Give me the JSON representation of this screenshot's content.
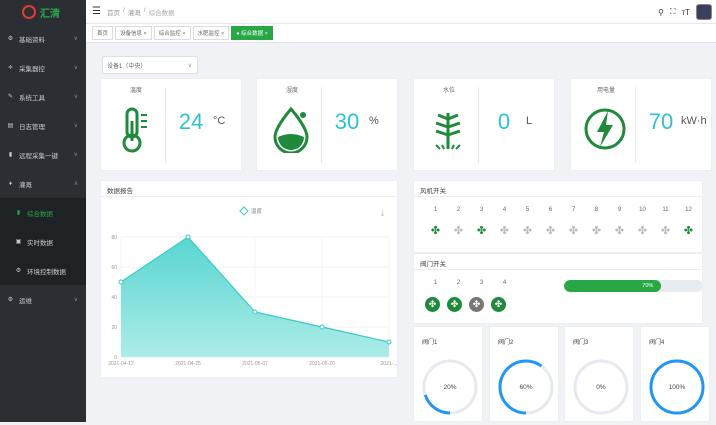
{
  "brand": {
    "name": "汇清"
  },
  "sidebar": {
    "items": [
      {
        "label": "基础资料",
        "icon": "gear-icon",
        "glyph": "⚙",
        "chev": "∨"
      },
      {
        "label": "采集器控",
        "icon": "sliders-icon",
        "glyph": "≑",
        "chev": "∨"
      },
      {
        "label": "系统工具",
        "icon": "wrench-icon",
        "glyph": "✎",
        "chev": "∨"
      },
      {
        "label": "日志管理",
        "icon": "doc-icon",
        "glyph": "▤",
        "chev": "∨"
      },
      {
        "label": "远程采集一键",
        "icon": "chart-icon",
        "glyph": "▮",
        "chev": "∨"
      },
      {
        "label": "灌溉",
        "icon": "droplet-icon",
        "glyph": "♦",
        "chev": "∧"
      },
      {
        "label": "综合数据",
        "icon": "bar-icon",
        "glyph": "▮",
        "sub": true,
        "active": true
      },
      {
        "label": "实时数据",
        "icon": "monitor-icon",
        "glyph": "▣",
        "sub": true
      },
      {
        "label": "环境控制数据",
        "icon": "gear-icon",
        "glyph": "⚙",
        "sub": true
      },
      {
        "label": "运维",
        "icon": "gear-icon",
        "glyph": "⚙",
        "chev": "∨"
      }
    ]
  },
  "header": {
    "hamburger": "☰",
    "breadcrumb": [
      "首页",
      "/",
      "灌溉",
      "/",
      "综合数据"
    ],
    "icons": [
      "⚲",
      "⛶",
      "тT"
    ]
  },
  "tabs": [
    {
      "label": "首页",
      "active": false
    },
    {
      "label": "设备信息 ×",
      "active": false
    },
    {
      "label": "综合监控 ×",
      "active": false
    },
    {
      "label": "水肥监控 ×",
      "active": false
    },
    {
      "label": "● 综合数据 ×",
      "active": true
    }
  ],
  "select": {
    "value": "设备1（中央）",
    "arrow": "∨"
  },
  "stats": [
    {
      "label": "温度",
      "value": "24",
      "unit": "°C",
      "icon": "thermometer-icon"
    },
    {
      "label": "湿度",
      "value": "30",
      "unit": "%",
      "icon": "water-drop-icon"
    },
    {
      "label": "水位",
      "value": "0",
      "unit": "L",
      "icon": "plant-icon"
    },
    {
      "label": "用电量",
      "value": "70",
      "unit": "kW·h",
      "icon": "lightning-icon"
    }
  ],
  "chart_data": {
    "type": "area",
    "title": "数据报告",
    "legend": "温度",
    "x": [
      "2021-04-12",
      "2021-04-25",
      "2021-05-07",
      "2021-05-20",
      "2021-..."
    ],
    "values": [
      50,
      80,
      30,
      20,
      10
    ],
    "ylim": [
      0,
      80
    ],
    "yticks": [
      0,
      20,
      40,
      60,
      80
    ],
    "grid": true,
    "color": "#3cc9c4"
  },
  "fans": {
    "title": "风机开关",
    "numbers": [
      "1",
      "2",
      "3",
      "4",
      "5",
      "6",
      "7",
      "8",
      "9",
      "10",
      "11",
      "12"
    ],
    "on": [
      true,
      false,
      true,
      false,
      false,
      false,
      false,
      false,
      false,
      false,
      false,
      true
    ]
  },
  "pumps": {
    "title": "阀门开关",
    "numbers": [
      "1",
      "2",
      "3",
      "4"
    ],
    "on": [
      true,
      true,
      false,
      true
    ],
    "progress_label": "70%",
    "progress": 0.7
  },
  "valves": [
    {
      "label": "阀门1",
      "pct": "20%",
      "value": 0.2
    },
    {
      "label": "阀门2",
      "pct": "60%",
      "value": 0.6
    },
    {
      "label": "阀门3",
      "pct": "0%",
      "value": 0
    },
    {
      "label": "阀门4",
      "pct": "100%",
      "value": 1.0
    }
  ],
  "colors": {
    "accent": "#28a745",
    "teal": "#29c5d0",
    "sidebar": "#2b2f33",
    "ring": "#2196f3"
  }
}
